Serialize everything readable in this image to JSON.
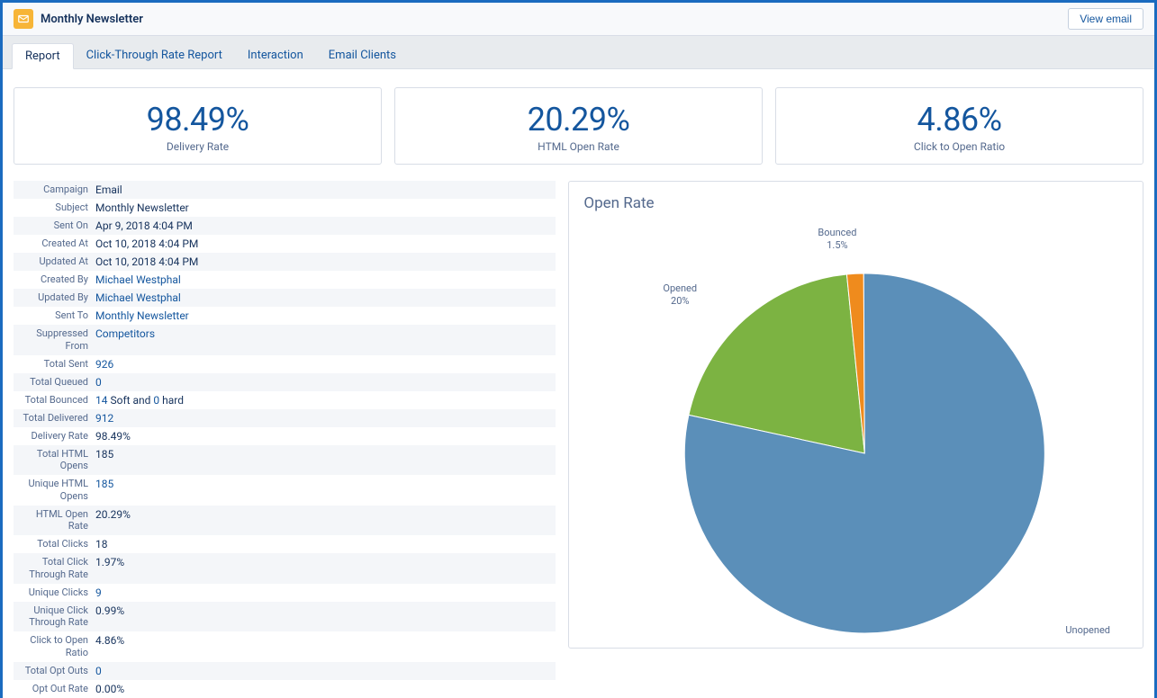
{
  "header": {
    "title": "Monthly Newsletter",
    "view_email_btn": "View email"
  },
  "tabs": {
    "report": "Report",
    "ctr": "Click-Through Rate Report",
    "interaction": "Interaction",
    "email_clients": "Email Clients"
  },
  "kpi": {
    "delivery_rate": {
      "value": "98.49%",
      "label": "Delivery Rate"
    },
    "html_open_rate": {
      "value": "20.29%",
      "label": "HTML Open Rate"
    },
    "click_to_open": {
      "value": "4.86%",
      "label": "Click to Open Ratio"
    }
  },
  "details": {
    "campaign": {
      "label": "Campaign",
      "value": "Email"
    },
    "subject": {
      "label": "Subject",
      "value": "Monthly Newsletter"
    },
    "sent_on": {
      "label": "Sent On",
      "value": "Apr 9, 2018 4:04 PM"
    },
    "created_at": {
      "label": "Created At",
      "value": "Oct 10, 2018 4:04 PM"
    },
    "updated_at": {
      "label": "Updated At",
      "value": "Oct 10, 2018 4:04 PM"
    },
    "created_by": {
      "label": "Created By",
      "value": "Michael Westphal"
    },
    "updated_by": {
      "label": "Updated By",
      "value": "Michael Westphal"
    },
    "sent_to": {
      "label": "Sent To",
      "value": "Monthly Newsletter"
    },
    "suppressed_from": {
      "label": "Suppressed From",
      "value": "Competitors"
    },
    "total_sent": {
      "label": "Total Sent",
      "value": "926"
    },
    "total_queued": {
      "label": "Total Queued",
      "value": "0"
    },
    "total_bounced": {
      "label": "Total Bounced",
      "value_soft": "14",
      "mid": " Soft and ",
      "value_hard": "0",
      "tail": " hard"
    },
    "total_delivered": {
      "label": "Total Delivered",
      "value": "912"
    },
    "delivery_rate": {
      "label": "Delivery Rate",
      "value": "98.49%"
    },
    "total_html_opens": {
      "label": "Total HTML Opens",
      "value": "185"
    },
    "unique_html_opens": {
      "label": "Unique HTML Opens",
      "value": "185"
    },
    "html_open_rate": {
      "label": "HTML Open Rate",
      "value": "20.29%"
    },
    "total_clicks": {
      "label": "Total Clicks",
      "value": "18"
    },
    "total_ctr": {
      "label": "Total Click Through Rate",
      "value": "1.97%"
    },
    "unique_clicks": {
      "label": "Unique Clicks",
      "value": "9"
    },
    "unique_ctr": {
      "label": "Unique Click Through Rate",
      "value": "0.99%"
    },
    "click_to_open_ratio": {
      "label": "Click to Open Ratio",
      "value": "4.86%"
    },
    "total_opt_outs": {
      "label": "Total Opt Outs",
      "value": "0"
    },
    "opt_out_rate": {
      "label": "Opt Out Rate",
      "value": "0.00%"
    }
  },
  "chart": {
    "title": "Open Rate",
    "labels": {
      "bounced": "Bounced\n1.5%",
      "opened": "Opened\n20%",
      "unopened": "Unopened"
    }
  },
  "chart_data": {
    "type": "pie",
    "title": "Open Rate",
    "series": [
      {
        "name": "Unopened",
        "value": 78.5,
        "color": "#5b8fb9"
      },
      {
        "name": "Opened",
        "value": 20.0,
        "color": "#7cb342"
      },
      {
        "name": "Bounced",
        "value": 1.5,
        "color": "#ef8b1d"
      }
    ]
  },
  "colors": {
    "unopened": "#5b8fb9",
    "opened": "#7cb342",
    "bounced": "#ef8b1d"
  }
}
